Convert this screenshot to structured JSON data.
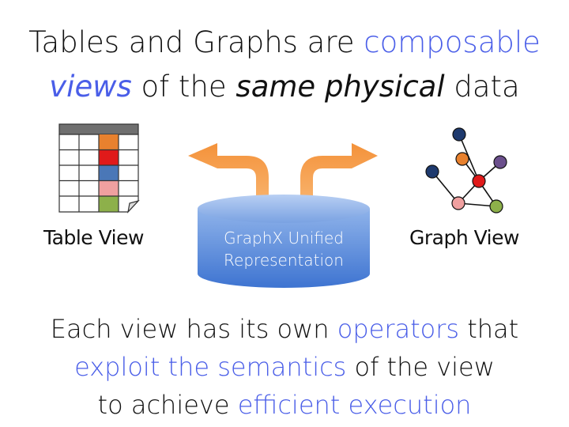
{
  "title": {
    "line1_a": "Tables and Graphs are ",
    "line1_b": "composable",
    "line2_a": "views",
    "line2_b": " of the ",
    "line2_c": "same physical",
    "line2_d": " data"
  },
  "labels": {
    "table_view": "Table View",
    "graph_view": "Graph View",
    "unified_line1": "GraphX Unified",
    "unified_line2": "Representation"
  },
  "caption": {
    "line1_a": "Each view has its own ",
    "line1_b": "operators",
    "line1_c": " that",
    "line2_a": "exploit the semantics",
    "line2_b": " of the view",
    "line3_a": "to achieve ",
    "line3_b": "efficient execution"
  },
  "colors": {
    "accent": "#4a5ee8",
    "arrow": "#f6a047",
    "cylinder": "#4b82db",
    "cell_orange": "#e8812e",
    "cell_red": "#e01a1a",
    "cell_blue": "#4a77b7",
    "cell_pink": "#f0a0a0",
    "cell_green": "#8db04a",
    "node_navy": "#1e3a6e",
    "node_purple": "#6b4f8c"
  }
}
